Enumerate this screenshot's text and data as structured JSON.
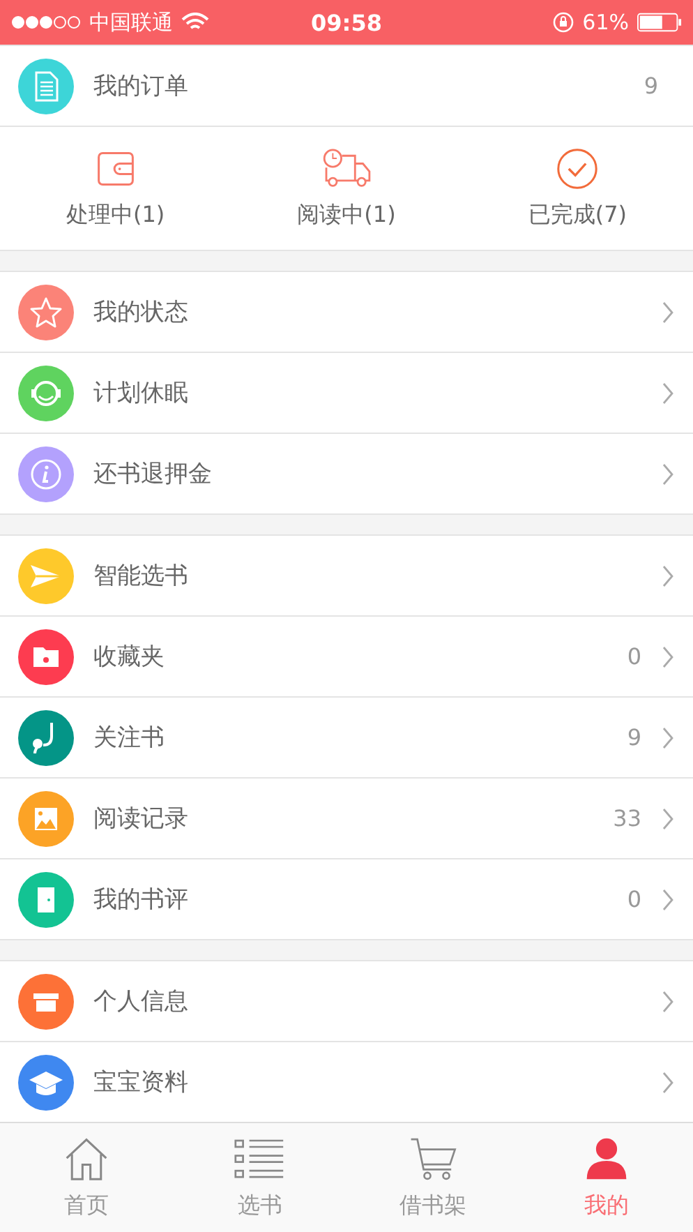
{
  "status_bar": {
    "carrier": "中国联通",
    "time": "09:58",
    "battery": "61%"
  },
  "order": {
    "label": "我的订单",
    "count": "9",
    "color": "#3dd5d8"
  },
  "order_states": [
    {
      "label": "处理中(1)"
    },
    {
      "label": "阅读中(1)"
    },
    {
      "label": "已完成(7)"
    }
  ],
  "groups": [
    [
      {
        "label": "我的状态",
        "color": "#fb8378"
      },
      {
        "label": "计划休眠",
        "color": "#5fd35f"
      },
      {
        "label": "还书退押金",
        "color": "#b3a1fd"
      }
    ],
    [
      {
        "label": "智能选书",
        "color": "#fec92b"
      },
      {
        "label": "收藏夹",
        "count": "0",
        "color": "#fd3c50"
      },
      {
        "label": "关注书",
        "count": "9",
        "color": "#049587"
      },
      {
        "label": "阅读记录",
        "count": "33",
        "color": "#fca326"
      },
      {
        "label": "我的书评",
        "count": "0",
        "color": "#13c393"
      }
    ],
    [
      {
        "label": "个人信息",
        "color": "#fd7137"
      },
      {
        "label": "宝宝资料",
        "color": "#3f88f0"
      }
    ]
  ],
  "tabs": [
    {
      "label": "首页",
      "selected": false
    },
    {
      "label": "选书",
      "selected": false
    },
    {
      "label": "借书架",
      "selected": false
    },
    {
      "label": "我的",
      "selected": true
    }
  ]
}
